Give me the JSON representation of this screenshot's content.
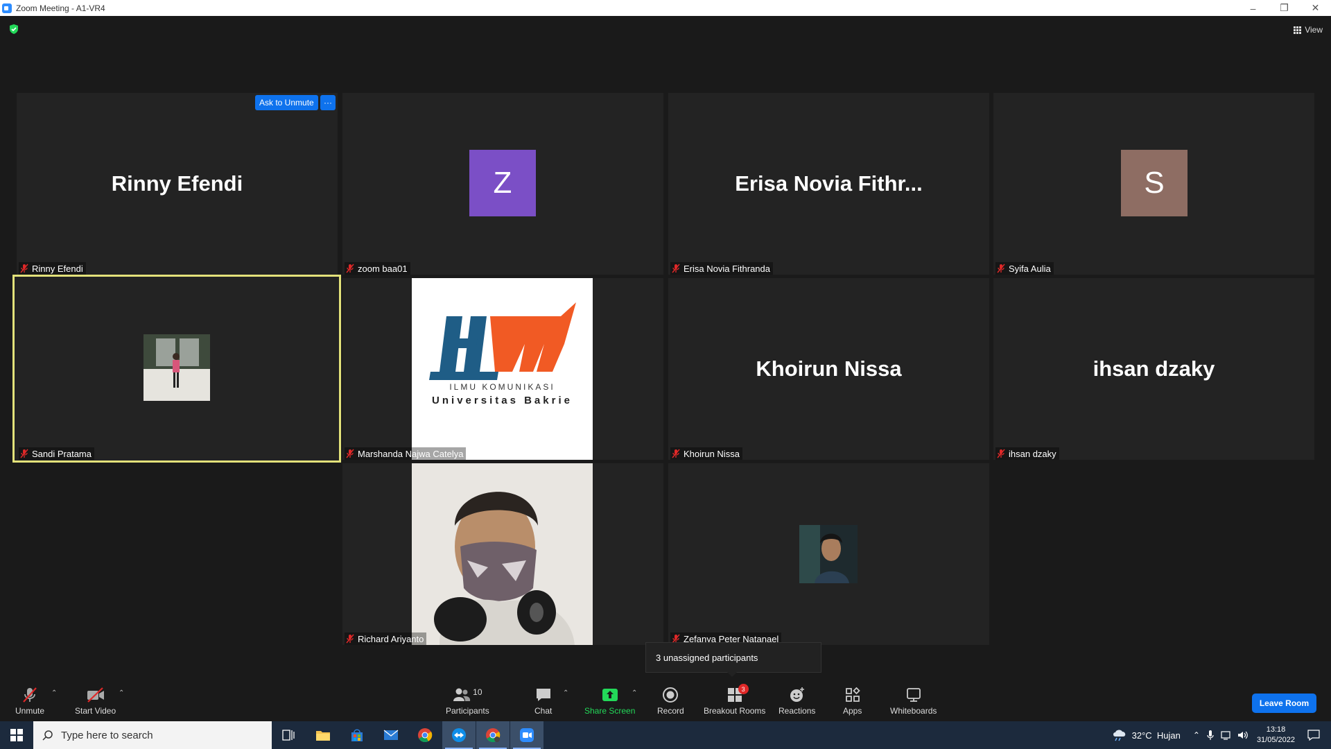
{
  "window": {
    "title": "Zoom Meeting - A1-VR4"
  },
  "header": {
    "view_label": "View"
  },
  "tiles": [
    {
      "display": "Rinny Efendi",
      "label": "Rinny Efendi"
    },
    {
      "avatar_letter": "Z",
      "avatar_color": "#7b4fc6",
      "label": "zoom baa01"
    },
    {
      "display": "Erisa Novia Fithr...",
      "label": "Erisa Novia Fithranda"
    },
    {
      "avatar_letter": "S",
      "avatar_color": "#8e6d63",
      "label": "Syifa Aulia"
    },
    {
      "label": "Sandi Pratama",
      "highlight_color": "#e3e27a"
    },
    {
      "label": "Marshanda Najwa Catelya",
      "logo": {
        "line1": "ILMU KOMUNIKASI",
        "line2": "Universitas Bakrie"
      }
    },
    {
      "display": "Khoirun Nissa",
      "label": "Khoirun Nissa"
    },
    {
      "display": "ihsan dzaky",
      "label": "ihsan dzaky"
    },
    {
      "label": "Richard Ariyanto"
    },
    {
      "label": "Zefanya Peter Natanael"
    }
  ],
  "ask_to_unmute": "Ask to Unmute",
  "more_options": "···",
  "tooltip": "3 unassigned participants",
  "toolbar": {
    "unmute": "Unmute",
    "start_video": "Start Video",
    "participants": "Participants",
    "participants_count": "10",
    "chat": "Chat",
    "share_screen": "Share Screen",
    "record": "Record",
    "breakout_rooms": "Breakout Rooms",
    "breakout_badge": "3",
    "reactions": "Reactions",
    "apps": "Apps",
    "whiteboards": "Whiteboards",
    "leave_room": "Leave Room"
  },
  "taskbar": {
    "search_placeholder": "Type here to search",
    "weather": "32°C  Hujan",
    "time": "13:18",
    "date": "31/05/2022"
  },
  "colors": {
    "accent": "#0e72ed",
    "share_green": "#23d959",
    "mute_red": "#e02828"
  }
}
